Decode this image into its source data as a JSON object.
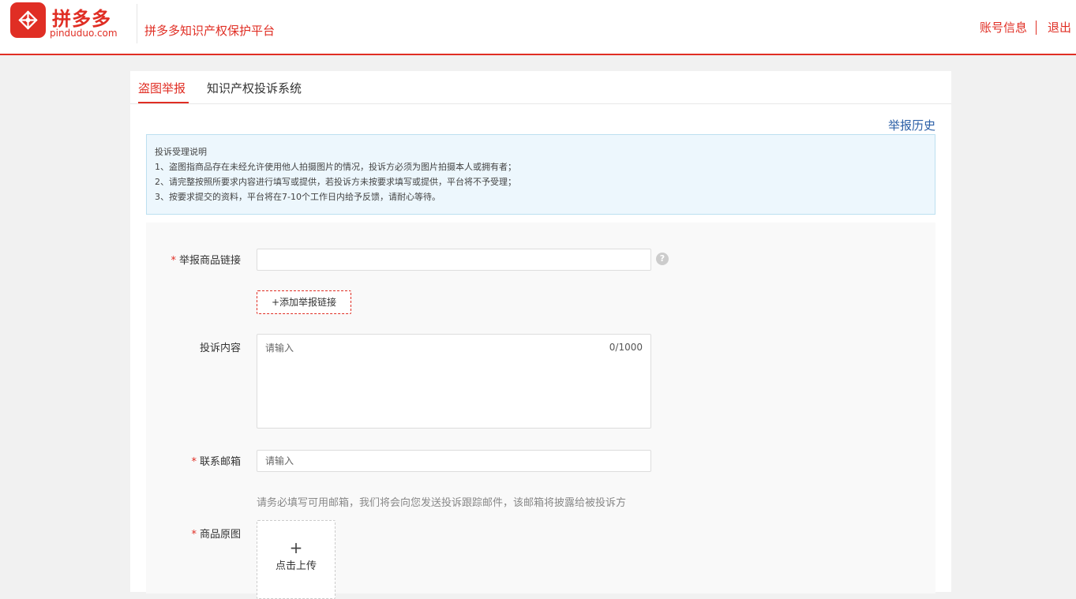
{
  "header": {
    "logo_name": "拼多多",
    "logo_domain": "pinduduo.com",
    "platform_title": "拼多多知识产权保护平台",
    "account_info": "账号信息",
    "logout": "退出"
  },
  "tabs": [
    {
      "label": "盗图举报",
      "active": true
    },
    {
      "label": "知识产权投诉系统",
      "active": false
    }
  ],
  "history_link": "举报历史",
  "notice": {
    "title": "投诉受理说明",
    "lines": [
      "1、盗图指商品存在未经允许使用他人拍摄图片的情况，投诉方必须为图片拍摄本人或拥有者；",
      "2、请完整按照所要求内容进行填写或提供，若投诉方未按要求填写或提供，平台将不予受理；",
      "3、按要求提交的资料，平台将在7-10个工作日内给予反馈，请耐心等待。"
    ]
  },
  "form": {
    "required_mark": "*",
    "product_link": {
      "label": "举报商品链接",
      "value": "",
      "help": "?"
    },
    "add_link_button": "+添加举报链接",
    "complaint": {
      "label": "投诉内容",
      "placeholder": "请输入",
      "count": "0/1000"
    },
    "email": {
      "label": "联系邮箱",
      "placeholder": "请输入",
      "hint": "请务必填写可用邮箱，我们将会向您发送投诉跟踪邮件，该邮箱将披露给被投诉方"
    },
    "original_image": {
      "label": "商品原图",
      "plus": "+",
      "upload_text": "点击上传"
    }
  },
  "colors": {
    "brand": "#e02e24",
    "link": "#2b5fa6",
    "notice_bg": "#edf7fd"
  }
}
